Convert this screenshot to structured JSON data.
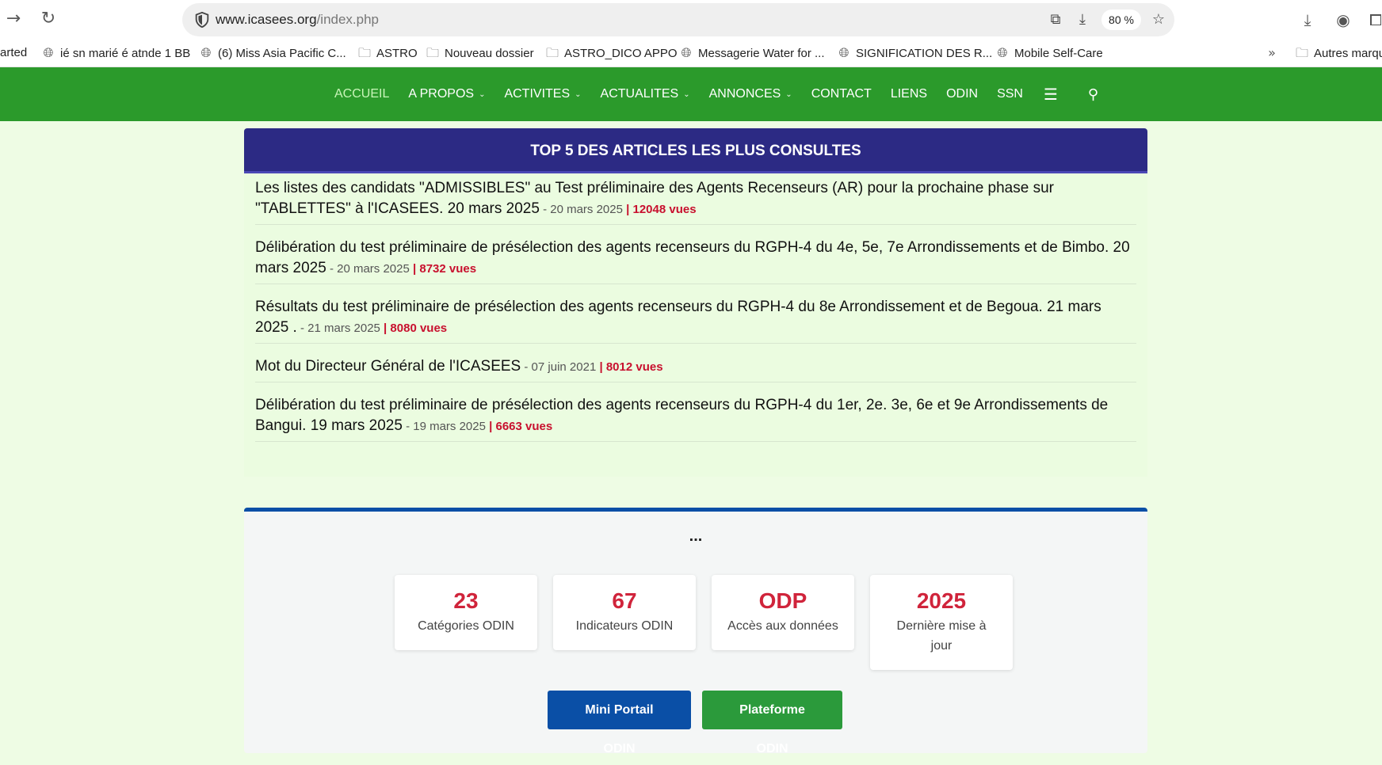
{
  "browser": {
    "url_host": "www.icasees.org",
    "url_path": "/index.php",
    "zoom": "80 %",
    "bookmarks": [
      "arted",
      "ié sn marié é atnde 1 BB",
      "(6) Miss Asia Pacific C...",
      "ASTRO",
      "Nouveau dossier",
      "ASTRO_DICO APPO",
      "Messagerie Water for ...",
      "SIGNIFICATION DES R...",
      "Mobile Self-Care",
      "Autres marqu"
    ]
  },
  "nav": {
    "items": [
      {
        "label": "ACCUEIL"
      },
      {
        "label": "A PROPOS"
      },
      {
        "label": "ACTIVITES"
      },
      {
        "label": "ACTUALITES"
      },
      {
        "label": "ANNONCES"
      },
      {
        "label": "CONTACT"
      },
      {
        "label": "LIENS"
      },
      {
        "label": "ODIN"
      },
      {
        "label": "SSN"
      }
    ]
  },
  "top5": {
    "title": "TOP 5 DES ARTICLES LES PLUS CONSULTES",
    "articles": [
      {
        "title": "Les listes des candidats \"ADMISSIBLES\" au Test préliminaire des Agents Recenseurs (AR) pour la prochaine phase sur \"TABLETTES\" à l'ICASEES. 20 mars 2025",
        "date": " - 20 mars 2025",
        "views": " | 12048 vues"
      },
      {
        "title": "Délibération du test préliminaire de présélection des agents recenseurs du RGPH-4 du 4e, 5e, 7e Arrondissements et de Bimbo. 20 mars 2025",
        "date": " - 20 mars 2025",
        "views": " | 8732 vues"
      },
      {
        "title": "Résultats du test préliminaire de présélection des agents recenseurs du RGPH-4 du 8e Arrondissement et de Begoua. 21 mars 2025 .",
        "date": " - 21 mars 2025",
        "views": " | 8080 vues"
      },
      {
        "title": "Mot du Directeur Général de l'ICASEES",
        "date": " - 07 juin 2021",
        "views": " | 8012 vues"
      },
      {
        "title": "Délibération du test préliminaire de présélection des agents recenseurs du RGPH-4 du 1er, 2e. 3e, 6e et 9e Arrondissements de Bangui. 19 mars 2025",
        "date": " - 19 mars 2025",
        "views": " | 6663 vues"
      }
    ]
  },
  "stats": {
    "heading": "...",
    "cards": [
      {
        "value": "23",
        "label": "Catégories ODIN"
      },
      {
        "value": "67",
        "label": "Indicateurs ODIN"
      },
      {
        "value": "ODP",
        "label": "Accès aux données"
      },
      {
        "value": "2025",
        "label": "Dernière mise à jour"
      }
    ],
    "buttons": {
      "mini_portail": "Mini Portail ODIN",
      "plateforme": "Plateforme ODIN"
    }
  },
  "colors": {
    "nav_green": "#2b9a2b",
    "panel_header": "#2c2a84",
    "views_red": "#c8102e",
    "stat_red": "#d0243b",
    "button_blue": "#0a4fa6",
    "button_green": "#2b9a3b"
  }
}
